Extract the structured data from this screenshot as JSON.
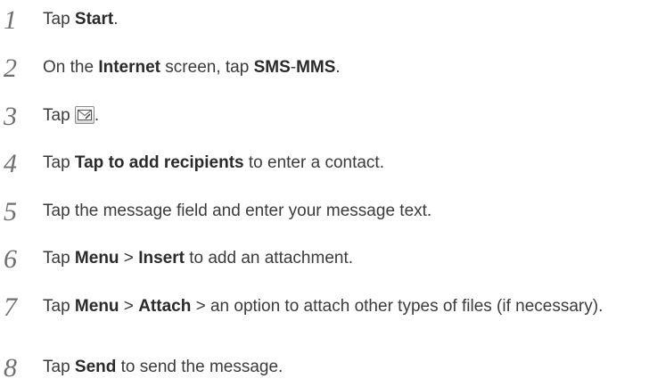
{
  "steps": [
    {
      "num": "1",
      "parts": [
        {
          "t": "Tap "
        },
        {
          "b": "Start"
        },
        {
          "t": "."
        }
      ]
    },
    {
      "num": "2",
      "parts": [
        {
          "t": "On the "
        },
        {
          "b": "Internet"
        },
        {
          "t": " screen, tap "
        },
        {
          "b": "SMS"
        },
        {
          "t": "-"
        },
        {
          "b": "MMS"
        },
        {
          "t": "."
        }
      ]
    },
    {
      "num": "3",
      "parts": [
        {
          "t": "Tap "
        },
        {
          "icon": "envelope-compose-icon"
        },
        {
          "t": "."
        }
      ]
    },
    {
      "num": "4",
      "parts": [
        {
          "t": "Tap "
        },
        {
          "b": "Tap to add recipients"
        },
        {
          "t": " to enter a contact."
        }
      ]
    },
    {
      "num": "5",
      "parts": [
        {
          "t": "Tap the message field and enter your message text."
        }
      ]
    },
    {
      "num": "6",
      "parts": [
        {
          "t": "Tap "
        },
        {
          "b": "Menu"
        },
        {
          "t": " > "
        },
        {
          "b": "Insert"
        },
        {
          "t": " to add an attachment."
        }
      ]
    },
    {
      "num": "7",
      "parts": [
        {
          "t": "Tap "
        },
        {
          "b": "Menu"
        },
        {
          "t": " > "
        },
        {
          "b": "Attach"
        },
        {
          "t": " > an option to attach other types of files (if necessary)."
        }
      ]
    },
    {
      "num": "8",
      "parts": [
        {
          "t": "Tap "
        },
        {
          "b": "Send"
        },
        {
          "t": " to send the message."
        }
      ]
    }
  ]
}
